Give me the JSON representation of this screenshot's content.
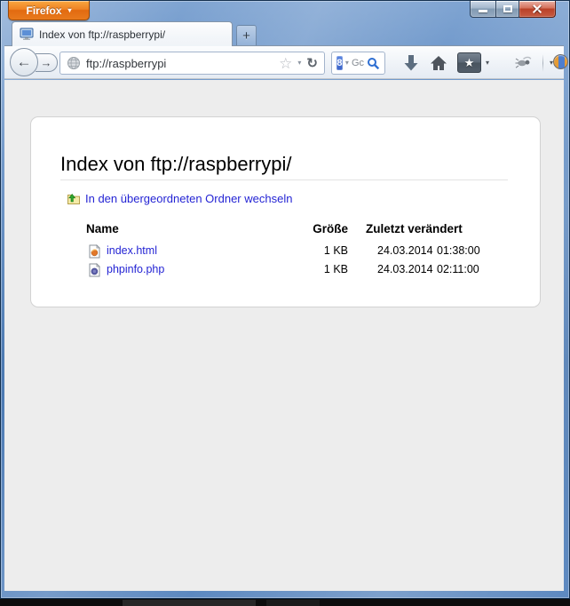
{
  "colors": {
    "glass_blue": "#5886bf",
    "firefox_orange": "#ef8324",
    "close_red": "#b94128",
    "link_blue": "#2424d4",
    "content_bg": "#ededed"
  },
  "titlebar": {
    "firefox_button_label": "Firefox"
  },
  "tabs": {
    "active_title": "Index von ftp://raspberrypi/",
    "new_tab_label": "+"
  },
  "toolbar": {
    "url_value": "ftp://raspberrypi",
    "search_engine_badge": "8",
    "search_text": "Gc"
  },
  "icons": {
    "back": "←",
    "forward": "→",
    "reload": "↻",
    "bookmark_star_outline": "☆",
    "dropdown_caret": "▾",
    "bookmark_star": "★"
  },
  "page": {
    "heading": "Index von ftp://raspberrypi/",
    "up_link_label": "In den übergeordneten Ordner wechseln"
  },
  "listing": {
    "headers": {
      "name": "Name",
      "size": "Größe",
      "modified": "Zuletzt verändert"
    },
    "rows": [
      {
        "icon": "firefox-html-file-icon",
        "name": "index.html",
        "size": "1 KB",
        "date": "24.03.2014",
        "time": "01:38:00"
      },
      {
        "icon": "php-file-icon",
        "name": "phpinfo.php",
        "size": "1 KB",
        "date": "24.03.2014",
        "time": "02:11:00"
      }
    ]
  }
}
